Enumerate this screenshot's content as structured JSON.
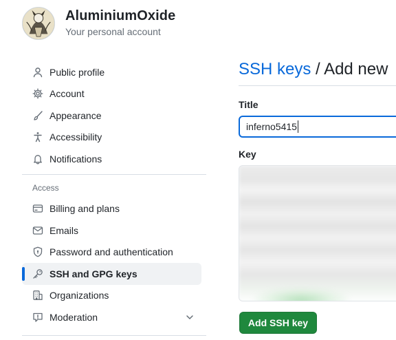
{
  "header": {
    "username": "AluminiumOxide",
    "subtitle": "Your personal account",
    "avatar": "avatar-illustration"
  },
  "sidebar": {
    "items_top": [
      {
        "label": "Public profile",
        "icon": "person-icon"
      },
      {
        "label": "Account",
        "icon": "gear-icon"
      },
      {
        "label": "Appearance",
        "icon": "paintbrush-icon"
      },
      {
        "label": "Accessibility",
        "icon": "accessibility-icon"
      },
      {
        "label": "Notifications",
        "icon": "bell-icon"
      }
    ],
    "section_access": "Access",
    "items_access": [
      {
        "label": "Billing and plans",
        "icon": "credit-card-icon"
      },
      {
        "label": "Emails",
        "icon": "mail-icon"
      },
      {
        "label": "Password and authentication",
        "icon": "shield-lock-icon"
      },
      {
        "label": "SSH and GPG keys",
        "icon": "key-icon",
        "active": true
      },
      {
        "label": "Organizations",
        "icon": "organization-icon"
      },
      {
        "label": "Moderation",
        "icon": "report-icon",
        "expandable": true
      }
    ]
  },
  "main": {
    "breadcrumb_link": "SSH keys",
    "breadcrumb_sep": " / ",
    "breadcrumb_current": "Add new",
    "title_label": "Title",
    "title_value": "inferno5415",
    "key_label": "Key",
    "submit_label": "Add SSH key"
  },
  "colors": {
    "accent": "#0969da",
    "primary_button": "#1f883d",
    "text": "#1f2328",
    "muted": "#656d76"
  }
}
